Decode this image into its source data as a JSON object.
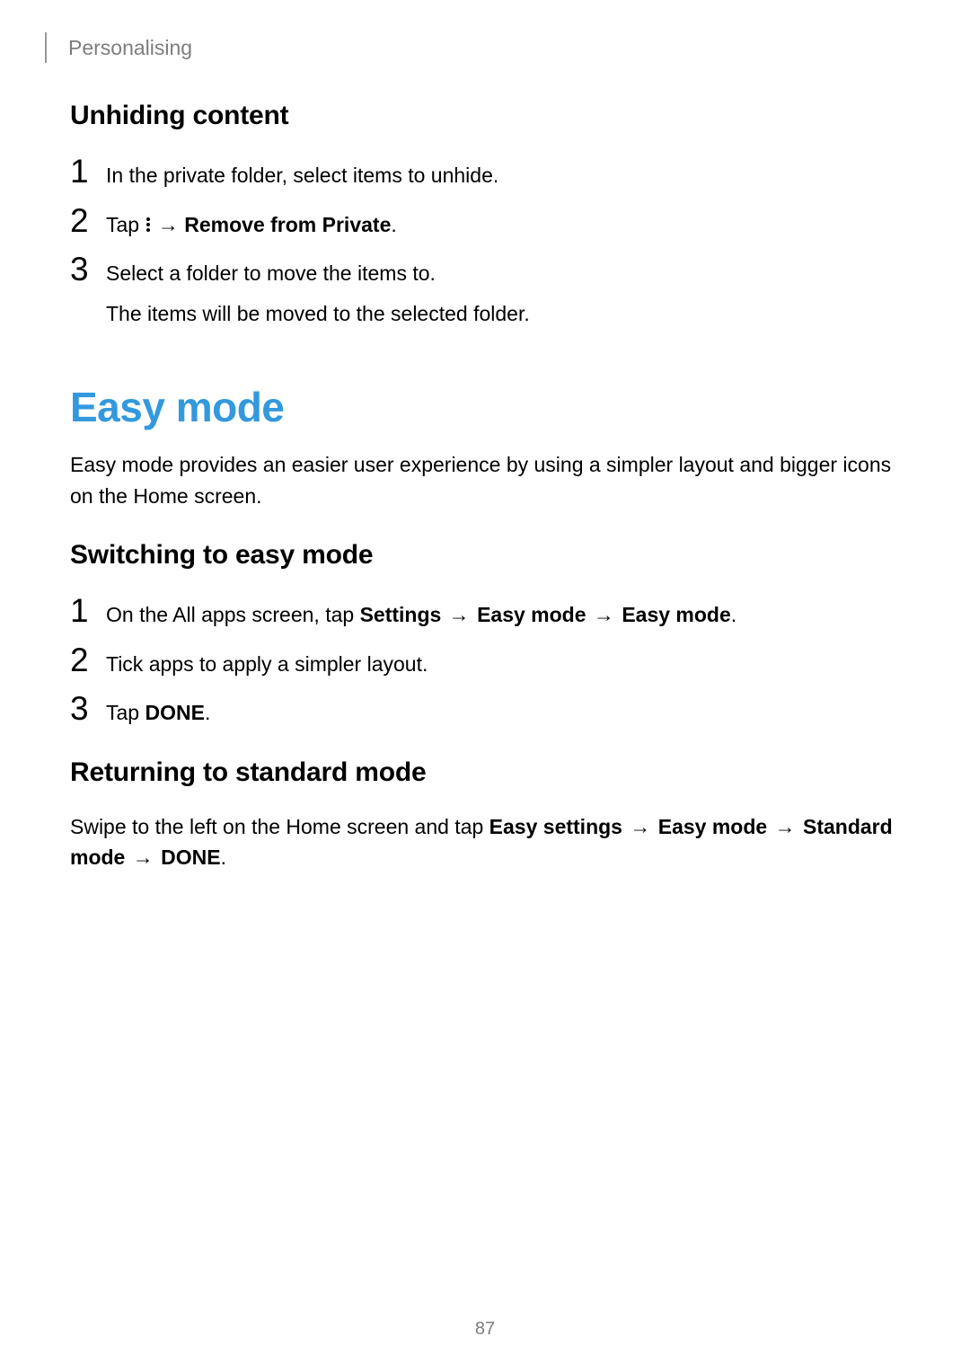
{
  "header": {
    "section": "Personalising"
  },
  "unhiding": {
    "title": "Unhiding content",
    "step1": "In the private folder, select items to unhide.",
    "step2_prefix": "Tap ",
    "step2_arrow": " → ",
    "step2_bold": "Remove from Private",
    "step2_suffix": ".",
    "step3_line1": "Select a folder to move the items to.",
    "step3_line2": "The items will be moved to the selected folder."
  },
  "easy_mode": {
    "title": "Easy mode",
    "intro": "Easy mode provides an easier user experience by using a simpler layout and bigger icons on the Home screen."
  },
  "switching": {
    "title": "Switching to easy mode",
    "step1_prefix": "On the All apps screen, tap ",
    "step1_b1": "Settings",
    "step1_a1": " → ",
    "step1_b2": "Easy mode",
    "step1_a2": " → ",
    "step1_b3": "Easy mode",
    "step1_suffix": ".",
    "step2": "Tick apps to apply a simpler layout.",
    "step3_prefix": "Tap ",
    "step3_bold": "DONE",
    "step3_suffix": "."
  },
  "returning": {
    "title": "Returning to standard mode",
    "p1_prefix": "Swipe to the left on the Home screen and tap ",
    "p1_b1": "Easy settings",
    "p1_a1": " → ",
    "p1_b2": "Easy mode",
    "p1_a2": " → ",
    "p1_b3": "Standard mode",
    "p1_a3": " → ",
    "p1_b4": "DONE",
    "p1_suffix": "."
  },
  "page_number": "87",
  "nums": {
    "n1": "1",
    "n2": "2",
    "n3": "3"
  }
}
